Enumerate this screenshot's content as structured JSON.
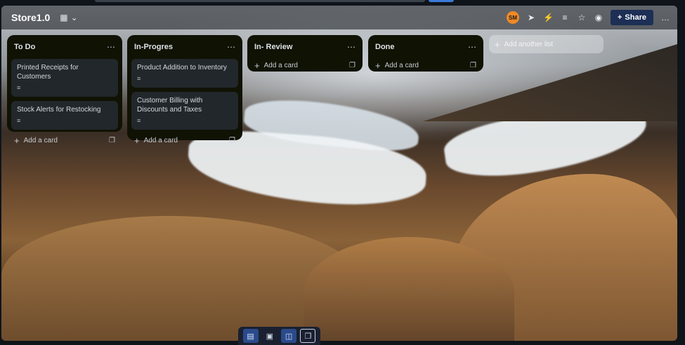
{
  "header": {
    "board_title": "Store1.0",
    "view_icon": "board-view-icon",
    "avatar_initials": "SM",
    "share_label": "Share",
    "more_label": "…"
  },
  "lists": [
    {
      "title": "To Do",
      "cards": [
        {
          "title": "Printed Receipts for Customers"
        },
        {
          "title": "Stock Alerts for Restocking"
        }
      ],
      "add_card": "Add a card"
    },
    {
      "title": "In-Progres",
      "cards": [
        {
          "title": "Product Addition to Inventory"
        },
        {
          "title": "Customer Billing with Discounts and Taxes"
        }
      ],
      "add_card": "Add a card"
    },
    {
      "title": "In- Review",
      "cards": [],
      "add_card": "Add a card"
    },
    {
      "title": "Done",
      "cards": [],
      "add_card": "Add a card"
    }
  ],
  "add_list_label": "Add another list",
  "colors": {
    "list_bg": "#101204",
    "card_bg": "#22272b",
    "share_bg": "#1d2f55",
    "avatar_bg": "#f08a24"
  }
}
